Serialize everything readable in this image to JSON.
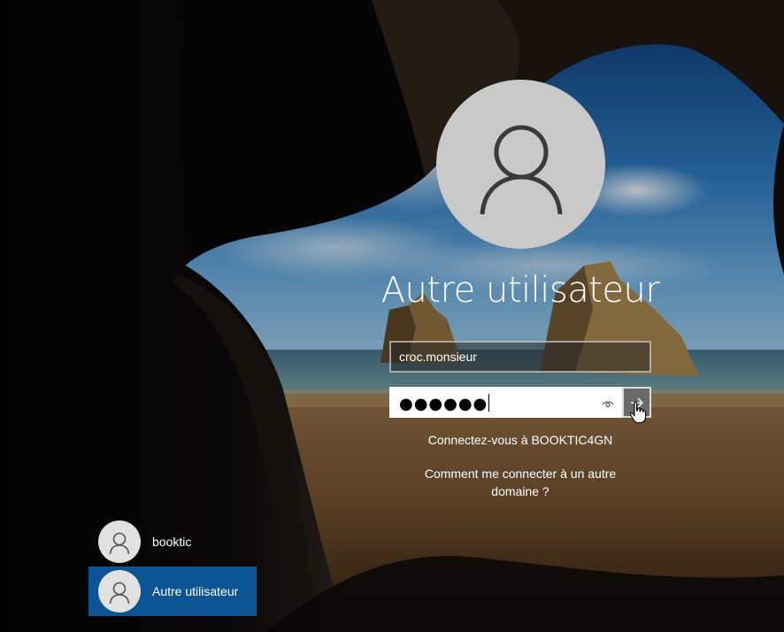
{
  "login": {
    "title": "Autre utilisateur",
    "username_value": "croc.monsieur",
    "password_masked": "●●●●●●",
    "sign_in_to": "Connectez-vous à BOOKTIC4GN",
    "other_domain_line1": "Comment me connecter à un autre",
    "other_domain_line2": "domaine ?"
  },
  "icons": {
    "avatar": "user-avatar-icon",
    "reveal": "eye-icon",
    "submit": "arrow-right-icon",
    "cursor": "hand-pointer-icon"
  },
  "users": [
    {
      "name": "booktic",
      "selected": false
    },
    {
      "name": "Autre utilisateur",
      "selected": true
    }
  ],
  "colors": {
    "selected_user_bg": "#0b5494",
    "avatar_bg": "#c9c9c9",
    "submit_bg": "#6a6a6a"
  }
}
